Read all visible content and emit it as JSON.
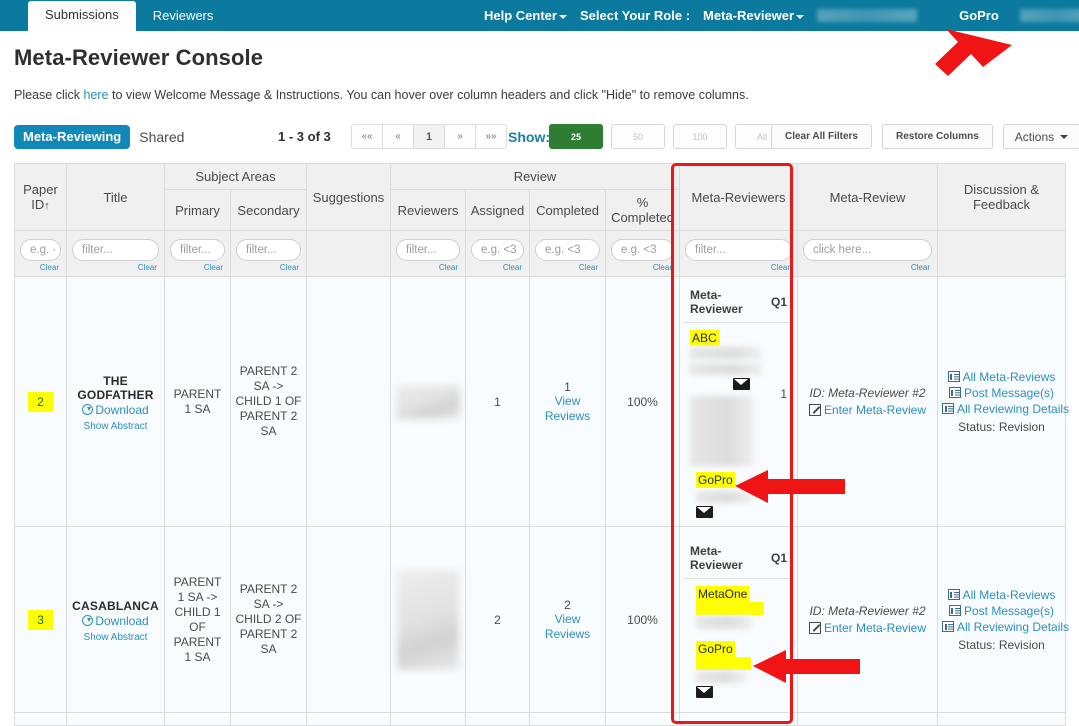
{
  "topnav": {
    "tabs": [
      {
        "label": "Submissions",
        "active": true
      },
      {
        "label": "Reviewers",
        "active": false
      }
    ],
    "help_center": "Help Center",
    "select_role_label": "Select Your Role :",
    "current_role": "Meta-Reviewer",
    "user": "GoPro",
    "brand_color": "#0b7a9e"
  },
  "page": {
    "title": "Meta-Reviewer Console",
    "intro_before": "Please click ",
    "intro_link": "here",
    "intro_after": " to view Welcome Message & Instructions. You can hover over column headers and click \"Hide\" to remove columns."
  },
  "toolbar": {
    "mode_badge": "Meta-Reviewing",
    "shared_label": "Shared",
    "record_count": "1 - 3 of 3",
    "pager": [
      "««",
      "«",
      "1",
      "»",
      "»»"
    ],
    "current_page": "1",
    "show_label": "Show:",
    "show_options": [
      "25",
      "50",
      "100",
      "All"
    ],
    "show_selected": "25",
    "clear_all_filters": "Clear All Filters",
    "restore_columns": "Restore Columns",
    "actions": "Actions",
    "accent_green": "#2f7d32",
    "accent_blue": "#1089b8"
  },
  "table": {
    "group_headers": {
      "subject_areas": "Subject Areas",
      "review": "Review"
    },
    "columns": [
      "Paper ID",
      "Title",
      "Primary",
      "Secondary",
      "Suggestions",
      "Reviewers",
      "Assigned",
      "Completed",
      "% Completed",
      "Meta-Reviewers",
      "Meta-Review",
      "Discussion & Feedback"
    ],
    "sort_indicator": "↑",
    "filters": {
      "paper_id": "e.g. ·",
      "title": "filter...",
      "primary": "filter...",
      "secondary": "filter...",
      "suggestions": "",
      "reviewers": "filter...",
      "assigned": "e.g. <3",
      "completed": "e.g. <3",
      "pct_completed": "e.g. <3",
      "meta_reviewers": "filter...",
      "meta_review": "click here...",
      "discussion": ""
    },
    "clear_label": "Clear",
    "rows": [
      {
        "paper_id": "2",
        "title": "THE GODFATHER",
        "download_label": "Download",
        "abstract_label": "Show Abstract",
        "primary_sa": "PARENT 1 SA",
        "secondary_sa": "PARENT 2 SA -> CHILD 1 OF PARENT 2 SA",
        "reviewers_redacted": true,
        "assigned": "1",
        "completed": "1",
        "view_reviews": "View Reviews",
        "pct_completed": "100%",
        "meta_reviewers": {
          "head_label": "Meta-Reviewer",
          "head_q": "Q1",
          "count": "1",
          "people": [
            {
              "highlight": "ABC",
              "redacted": true,
              "has_email": true,
              "second_bar": false
            },
            {
              "highlight": "GoPro",
              "redacted": true,
              "has_email": true,
              "second_bar": false
            }
          ]
        },
        "meta_review_id": "ID: Meta-Reviewer #2",
        "enter_meta_review": "Enter Meta-Review",
        "discussion": {
          "all_meta_reviews": "All Meta-Reviews",
          "post_messages": "Post Message(s)",
          "all_reviewing_details": "All Reviewing Details",
          "status": "Status: Revision"
        }
      },
      {
        "paper_id": "3",
        "title": "CASABLANCA",
        "download_label": "Download",
        "abstract_label": "Show Abstract",
        "primary_sa": "PARENT 1 SA -> CHILD 1 OF PARENT 1 SA",
        "secondary_sa": "PARENT 2 SA -> CHILD 2 OF PARENT 2 SA",
        "reviewers_redacted": true,
        "assigned": "2",
        "completed": "2",
        "view_reviews": "View Reviews",
        "pct_completed": "100%",
        "meta_reviewers": {
          "head_label": "Meta-Reviewer",
          "head_q": "Q1",
          "count": "",
          "people": [
            {
              "highlight": "MetaOne",
              "redacted": true,
              "has_email": false,
              "second_bar": true
            },
            {
              "highlight": "GoPro",
              "redacted": true,
              "has_email": true,
              "second_bar": false
            }
          ]
        },
        "meta_review_id": "ID: Meta-Reviewer #2",
        "enter_meta_review": "Enter Meta-Review",
        "discussion": {
          "all_meta_reviews": "All Meta-Reviews",
          "post_messages": "Post Message(s)",
          "all_reviewing_details": "All Reviewing Details",
          "status": "Status: Revision"
        }
      }
    ]
  },
  "annotations": {
    "highlight_color": "#ffff00",
    "arrow_color": "#f01414",
    "callouts": [
      "arrow-to-gopro-user-menu",
      "arrow-to-gopro-row-2",
      "arrow-to-gopro-row-3",
      "red-box-meta-reviewers-column"
    ]
  }
}
